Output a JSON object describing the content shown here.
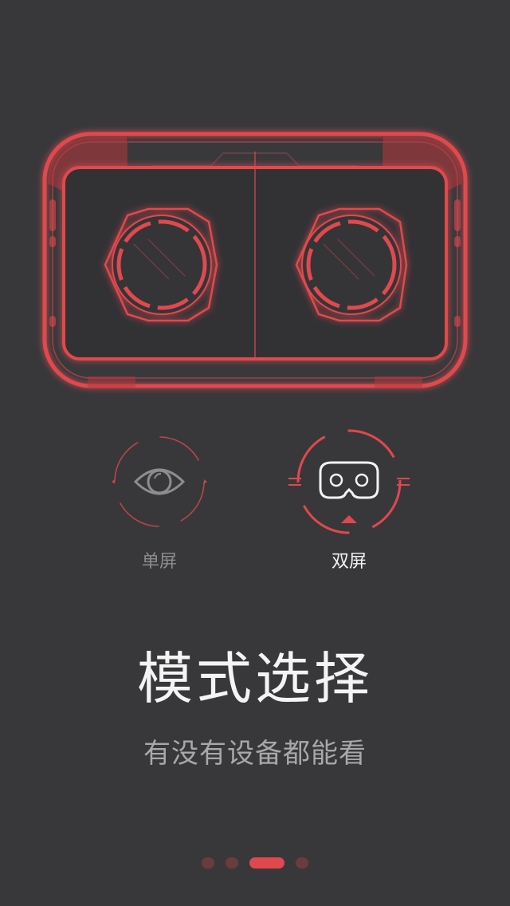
{
  "colors": {
    "background": "#38383b",
    "accent": "#e0484d",
    "dot_inactive": "#6a3c3e"
  },
  "illustration": {
    "name": "vr-headset-dual-lens-illustration"
  },
  "modes": [
    {
      "label": "单屏",
      "icon": "eye-icon",
      "selected": false
    },
    {
      "label": "双屏",
      "icon": "vr-goggles-icon",
      "selected": true
    }
  ],
  "title": "模式选择",
  "subtitle": "有没有设备都能看",
  "pager": {
    "total": 4,
    "active_index": 3
  }
}
